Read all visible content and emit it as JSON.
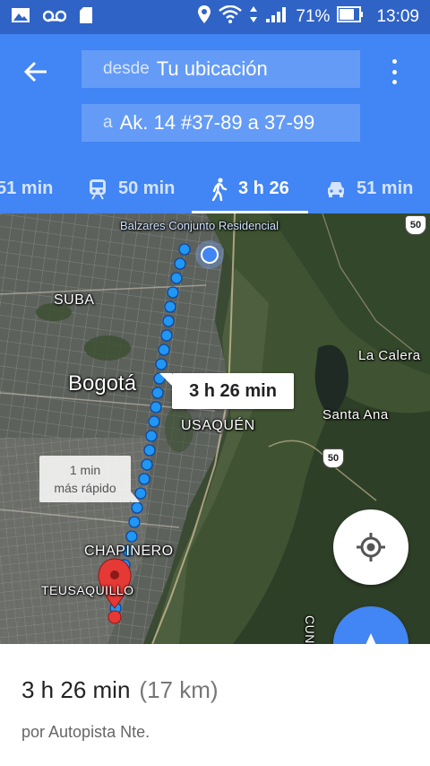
{
  "status_bar": {
    "battery": "71%",
    "time": "13:09",
    "icons": [
      "image-icon",
      "voicemail-icon",
      "sd-card-icon",
      "location-icon",
      "wifi-icon",
      "data-arrows-icon",
      "signal-icon",
      "battery-icon"
    ]
  },
  "header": {
    "back_icon": "arrow-left-icon",
    "menu_icon": "more-vert-icon",
    "from": {
      "prefix": "desde",
      "value": "Tu ubicación"
    },
    "to": {
      "prefix": "a",
      "value": "Ak. 14 #37-89 a 37-99"
    }
  },
  "tabs": [
    {
      "mode": "car",
      "icon": "car-icon",
      "label": "51 min"
    },
    {
      "mode": "transit",
      "icon": "train-icon",
      "label": "50 min"
    },
    {
      "mode": "walk",
      "icon": "walk-icon",
      "label": "3 h 26",
      "active": true
    },
    {
      "mode": "car",
      "icon": "car-icon",
      "label": "51 min"
    }
  ],
  "map": {
    "labels": {
      "poi": "Balzares Conjunto Residencial",
      "suba": "SUBA",
      "bogota": "Bogotá",
      "usaquen": "USAQUÉN",
      "la_calera": "La Calera",
      "santa_ana": "Santa Ana",
      "chapinero": "CHAPINERO",
      "teusaquillo": "TEUSAQUILLO",
      "cund": "CUND"
    },
    "route_shields": [
      "50",
      "50"
    ],
    "time_callout": "3 h 26 min",
    "alt_callout": {
      "line1": "1 min",
      "line2": "más rápido"
    },
    "colors": {
      "route": "#2196f3",
      "accent": "#4285f4",
      "pin": "#e53935"
    }
  },
  "fab": {
    "my_location_icon": "my-location-icon",
    "navigate_icon": "navigation-arrow-icon"
  },
  "summary": {
    "duration": "3 h 26 min",
    "distance": "(17 km)",
    "via": "por Autopista Nte."
  }
}
